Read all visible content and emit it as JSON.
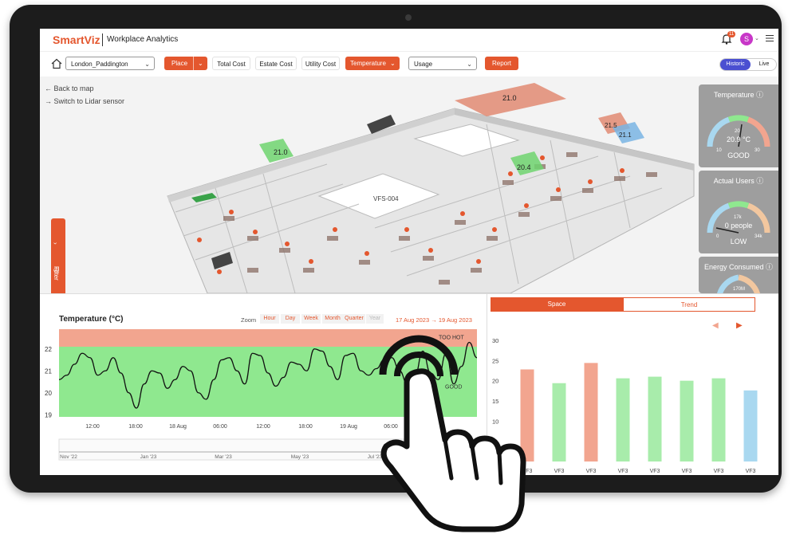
{
  "app": {
    "brand": "SmartViz",
    "title": "Workplace Analytics"
  },
  "header": {
    "notification_count": "11",
    "avatar_initial": "S"
  },
  "toolbar": {
    "location": "London_Paddington",
    "place": "Place",
    "total_cost": "Total Cost",
    "estate_cost": "Estate Cost",
    "utility_cost": "Utility Cost",
    "temperature": "Temperature",
    "usage": "Usage",
    "report": "Report",
    "historic": "Historic",
    "live": "Live"
  },
  "floorplan": {
    "back_link": "Back to map",
    "switch_link": "Switch to Lidar sensor",
    "filter_label": "Filter",
    "zone_labels": [
      "21.0",
      "20.4",
      "21.0",
      "21.5",
      "21.1"
    ],
    "zone_id": "VFS-004"
  },
  "gauges": [
    {
      "title": "Temperature",
      "value": "20.9 °C",
      "status": "GOOD",
      "min": "10",
      "max": "30",
      "mid": "20",
      "level": 0.55
    },
    {
      "title": "Actual Users",
      "value": "0 people",
      "status": "LOW",
      "min": "0",
      "max": "34k",
      "mid": "17k",
      "level": 0.0
    },
    {
      "title": "Energy Consumed",
      "mid": "170M",
      "level": 0.5
    }
  ],
  "temperature_panel": {
    "title": "Temperature (°C)",
    "zoom_label": "Zoom",
    "zoom_options": [
      "Hour",
      "Day",
      "Week",
      "Month",
      "Quarter",
      "Year"
    ],
    "date_from": "17 Aug 2023",
    "date_to": "19 Aug 2023",
    "arrow": "→",
    "band_hot": "TOO HOT",
    "band_good": "GOOD",
    "nav_labels": [
      "Nov '22",
      "Jan '23",
      "Mar '23",
      "May '23",
      "Jul '23"
    ]
  },
  "space_panel": {
    "tab_space": "Space",
    "tab_trend": "Trend"
  },
  "chart_data": [
    {
      "type": "line",
      "title": "Temperature (°C)",
      "x_ticks": [
        "12:00",
        "18:00",
        "18 Aug",
        "06:00",
        "12:00",
        "18:00",
        "19 Aug",
        "06:00"
      ],
      "y_ticks": [
        19,
        20,
        21,
        22
      ],
      "ylim": [
        18.9,
        22.9
      ],
      "bands": [
        {
          "label": "TOO HOT",
          "from": 22.1,
          "to": 22.9,
          "color": "#f2a58f"
        },
        {
          "label": "GOOD",
          "from": 18.9,
          "to": 22.1,
          "color": "#8fe88f"
        }
      ],
      "series": [
        {
          "values": [
            20.6,
            20.8,
            21.3,
            21.8,
            21.6,
            20.8,
            21.0,
            21.6,
            20.9,
            20.0,
            19.3,
            20.4,
            21.0,
            20.9,
            20.2,
            20.6,
            21.2,
            21.0,
            20.0,
            19.7,
            20.6,
            21.5,
            21.6,
            21.0,
            20.4,
            21.8,
            21.7,
            20.9,
            20.3,
            20.7,
            21.4,
            21.3,
            21.0,
            22.0,
            21.9,
            21.2,
            20.6,
            21.7,
            21.8,
            21.0,
            20.8,
            21.1,
            21.5,
            21.6,
            21.0,
            20.4,
            20.8,
            21.9,
            20.9,
            20.6,
            21.8,
            20.4,
            21.2,
            22.3,
            21.6
          ]
        }
      ]
    },
    {
      "type": "bar",
      "categories": [
        "VF3",
        "VF3",
        "VF3",
        "VF3",
        "VF3",
        "VF3",
        "VF3",
        "VF3"
      ],
      "values": [
        22.8,
        19.4,
        24.4,
        20.6,
        21.0,
        20.0,
        20.6,
        17.6
      ],
      "colors": [
        "#f2a58f",
        "#a8ecab",
        "#f2a58f",
        "#a8ecab",
        "#a8ecab",
        "#a8ecab",
        "#a8ecab",
        "#a9d8f0"
      ],
      "y_ticks": [
        10,
        15,
        20,
        25,
        30
      ],
      "ylim": [
        0,
        30
      ]
    }
  ]
}
